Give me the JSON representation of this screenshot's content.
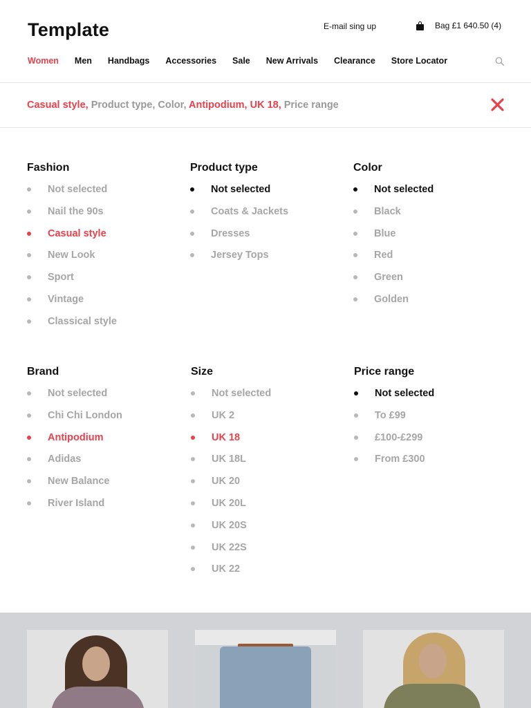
{
  "header": {
    "logo": "Template",
    "signup": "E-mail sing up",
    "bag": "Bag £1 640.50 (4)"
  },
  "nav": [
    "Women",
    "Men",
    "Handbags",
    "Accessories",
    "Sale",
    "New Arrivals",
    "Clearance",
    "Store Locator"
  ],
  "summary": [
    {
      "text": "Casual style,",
      "selected": true
    },
    {
      "text": "Product type,",
      "selected": false
    },
    {
      "text": "Color,",
      "selected": false
    },
    {
      "text": "Antipodium,",
      "selected": true
    },
    {
      "text": "UK 18,",
      "selected": true
    },
    {
      "text": "Price range",
      "selected": false
    }
  ],
  "filters": {
    "fashion": {
      "title": "Fashion",
      "items": [
        "Not selected",
        "Nail the 90s",
        "Casual style",
        "New Look",
        "Sport",
        "Vintage",
        "Classical style"
      ],
      "active": "Casual style"
    },
    "product_type": {
      "title": "Product type",
      "items": [
        "Not selected",
        "Coats & Jackets",
        "Dresses",
        "Jersey Tops"
      ],
      "active": "Not selected"
    },
    "color": {
      "title": "Color",
      "items": [
        "Not selected",
        "Black",
        "Blue",
        "Red",
        "Green",
        "Golden"
      ],
      "active": "Not selected"
    },
    "brand": {
      "title": "Brand",
      "items": [
        "Not selected",
        "Chi Chi London",
        "Antipodium",
        "Adidas",
        "New Balance",
        "River Island"
      ],
      "active": "Antipodium"
    },
    "size": {
      "title": "Size",
      "items": [
        "Not selected",
        "UK 2",
        "UK 18",
        "UK 18L",
        "UK 20",
        "UK 20L",
        "UK 20S",
        "UK 22S",
        "UK 22"
      ],
      "active": "UK 18"
    },
    "price_range": {
      "title": "Price range",
      "items": [
        "Not selected",
        "To £99",
        "£100-£299",
        "From £300"
      ],
      "active": "Not selected"
    }
  },
  "colors": {
    "accent": "#e8414b",
    "muted": "#a6a6a6",
    "text": "#111111"
  }
}
